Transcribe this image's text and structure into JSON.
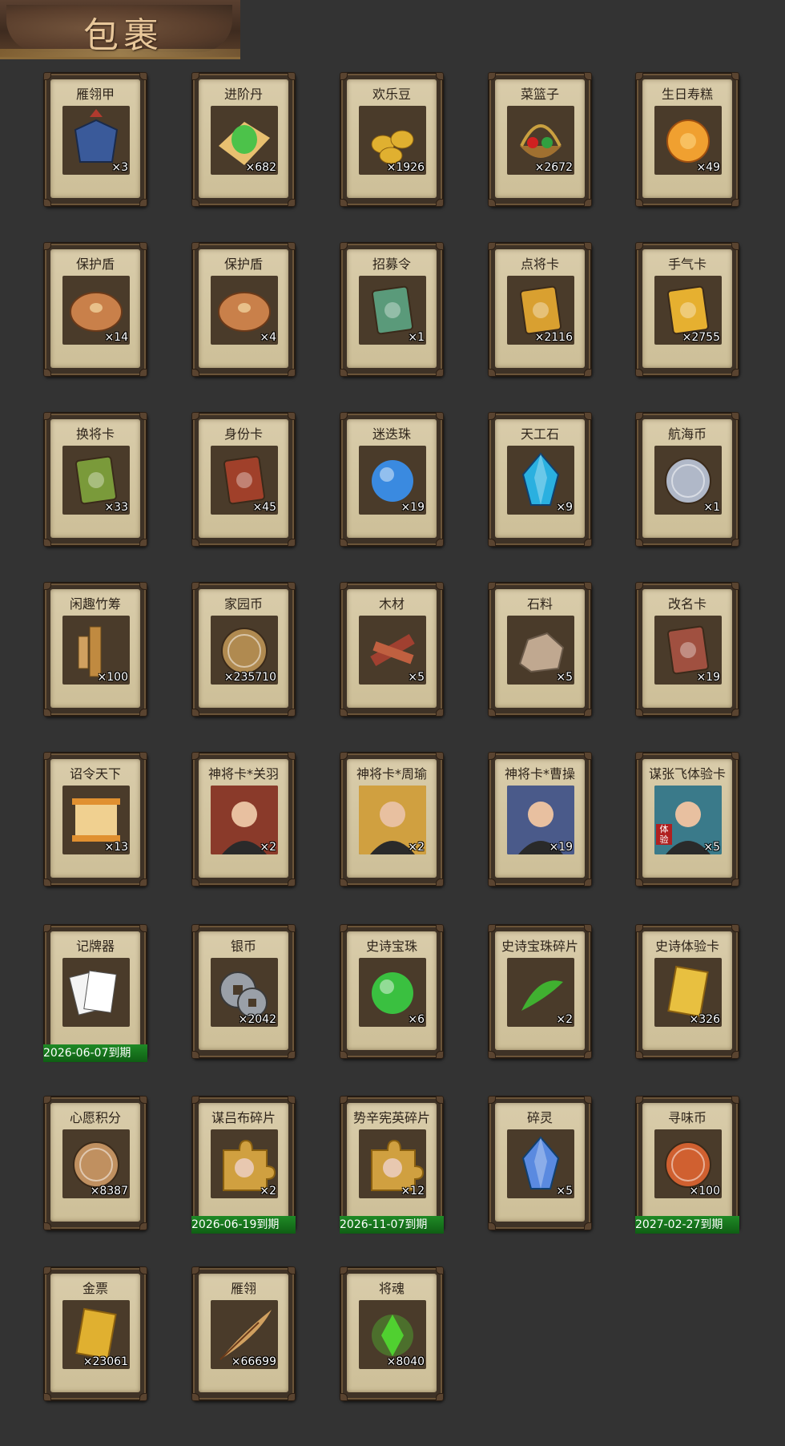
{
  "header": {
    "title": "包裹"
  },
  "items": [
    {
      "name": "雁翎甲",
      "count": "×3",
      "icon": "armor-icon",
      "color": "#b03a2e"
    },
    {
      "name": "进阶丹",
      "count": "×682",
      "icon": "green-pill-icon",
      "color": "#4cc24a"
    },
    {
      "name": "欢乐豆",
      "count": "×1926",
      "icon": "gold-beans-icon",
      "color": "#e0b030"
    },
    {
      "name": "菜篮子",
      "count": "×2672",
      "icon": "basket-icon",
      "color": "#c9a040"
    },
    {
      "name": "生日寿糕",
      "count": "×49",
      "icon": "cake-icon",
      "color": "#f0a030"
    },
    {
      "name": "保护盾",
      "count": "×14",
      "icon": "shield-icon",
      "color": "#c9804a"
    },
    {
      "name": "保护盾",
      "count": "×4",
      "icon": "shield-icon",
      "color": "#c9804a"
    },
    {
      "name": "招募令",
      "count": "×1",
      "icon": "recruit-token-icon",
      "color": "#5a9a7a"
    },
    {
      "name": "点将卡",
      "count": "×2116",
      "icon": "general-card-icon",
      "color": "#d9a030"
    },
    {
      "name": "手气卡",
      "count": "×2755",
      "icon": "luck-card-icon",
      "color": "#e6b030"
    },
    {
      "name": "换将卡",
      "count": "×33",
      "icon": "swap-card-icon",
      "color": "#7a9a3a"
    },
    {
      "name": "身份卡",
      "count": "×45",
      "icon": "identity-card-icon",
      "color": "#a0402a"
    },
    {
      "name": "迷迭珠",
      "count": "×19",
      "icon": "blue-orb-icon",
      "color": "#3a8ae0"
    },
    {
      "name": "天工石",
      "count": "×9",
      "icon": "blue-crystal-icon",
      "color": "#2ab0e0"
    },
    {
      "name": "航海币",
      "count": "×1",
      "icon": "silver-coin-icon",
      "color": "#b0b8c8"
    },
    {
      "name": "闲趣竹筹",
      "count": "×100",
      "icon": "bamboo-tag-icon",
      "color": "#c08a40"
    },
    {
      "name": "家园币",
      "count": "×235710",
      "icon": "bronze-coin-icon",
      "color": "#b08a50"
    },
    {
      "name": "木材",
      "count": "×5",
      "icon": "wood-icon",
      "color": "#a04030"
    },
    {
      "name": "石料",
      "count": "×5",
      "icon": "stone-icon",
      "color": "#c0a890"
    },
    {
      "name": "改名卡",
      "count": "×19",
      "icon": "rename-card-icon",
      "color": "#a05040"
    },
    {
      "name": "诏令天下",
      "count": "×13",
      "icon": "scroll-icon",
      "color": "#e09030"
    },
    {
      "name": "神将卡*关羽",
      "count": "×2",
      "icon": "portrait-guanyu-icon",
      "color": "#8a3a2a"
    },
    {
      "name": "神将卡*周瑜",
      "count": "×2",
      "icon": "portrait-zhouyu-icon",
      "color": "#d0a040"
    },
    {
      "name": "神将卡*曹操",
      "count": "×19",
      "icon": "portrait-caocao-icon",
      "color": "#4a5a8a"
    },
    {
      "name": "谋张飞体验卡",
      "count": "×5",
      "icon": "portrait-zhangfei-icon",
      "color": "#3a7a8a",
      "badge": "体验"
    },
    {
      "name": "记牌器",
      "count": "",
      "icon": "playing-cards-icon",
      "color": "#e8e8e8",
      "expiry": "2026-06-07到期"
    },
    {
      "name": "银币",
      "count": "×2042",
      "icon": "silver-coins-icon",
      "color": "#9aa0a8"
    },
    {
      "name": "史诗宝珠",
      "count": "×6",
      "icon": "green-orb-icon",
      "color": "#3ac040"
    },
    {
      "name": "史诗宝珠碎片",
      "count": "×2",
      "icon": "green-shard-icon",
      "color": "#40b030"
    },
    {
      "name": "史诗体验卡",
      "count": "×326",
      "icon": "gold-card-icon",
      "color": "#e8c040"
    },
    {
      "name": "心愿积分",
      "count": "×8387",
      "icon": "heart-coin-icon",
      "color": "#c09060"
    },
    {
      "name": "谋吕布碎片",
      "count": "×2",
      "icon": "puzzle-lvbu-icon",
      "color": "#d0a040",
      "expiry": "2026-06-19到期"
    },
    {
      "name": "势辛宪英碎片",
      "count": "×12",
      "icon": "puzzle-xinxianying-icon",
      "color": "#d0a040",
      "expiry": "2026-11-07到期"
    },
    {
      "name": "碎灵",
      "count": "×5",
      "icon": "crystal-shard-icon",
      "color": "#5a8ae0"
    },
    {
      "name": "寻味币",
      "count": "×100",
      "icon": "taste-coin-icon",
      "color": "#d06030",
      "expiry": "2027-02-27到期"
    },
    {
      "name": "金票",
      "count": "×23061",
      "icon": "gold-ticket-icon",
      "color": "#e0b030"
    },
    {
      "name": "雁翎",
      "count": "×66699",
      "icon": "feather-icon",
      "color": "#d0a060"
    },
    {
      "name": "将魂",
      "count": "×8040",
      "icon": "green-spirit-icon",
      "color": "#50d030"
    }
  ]
}
